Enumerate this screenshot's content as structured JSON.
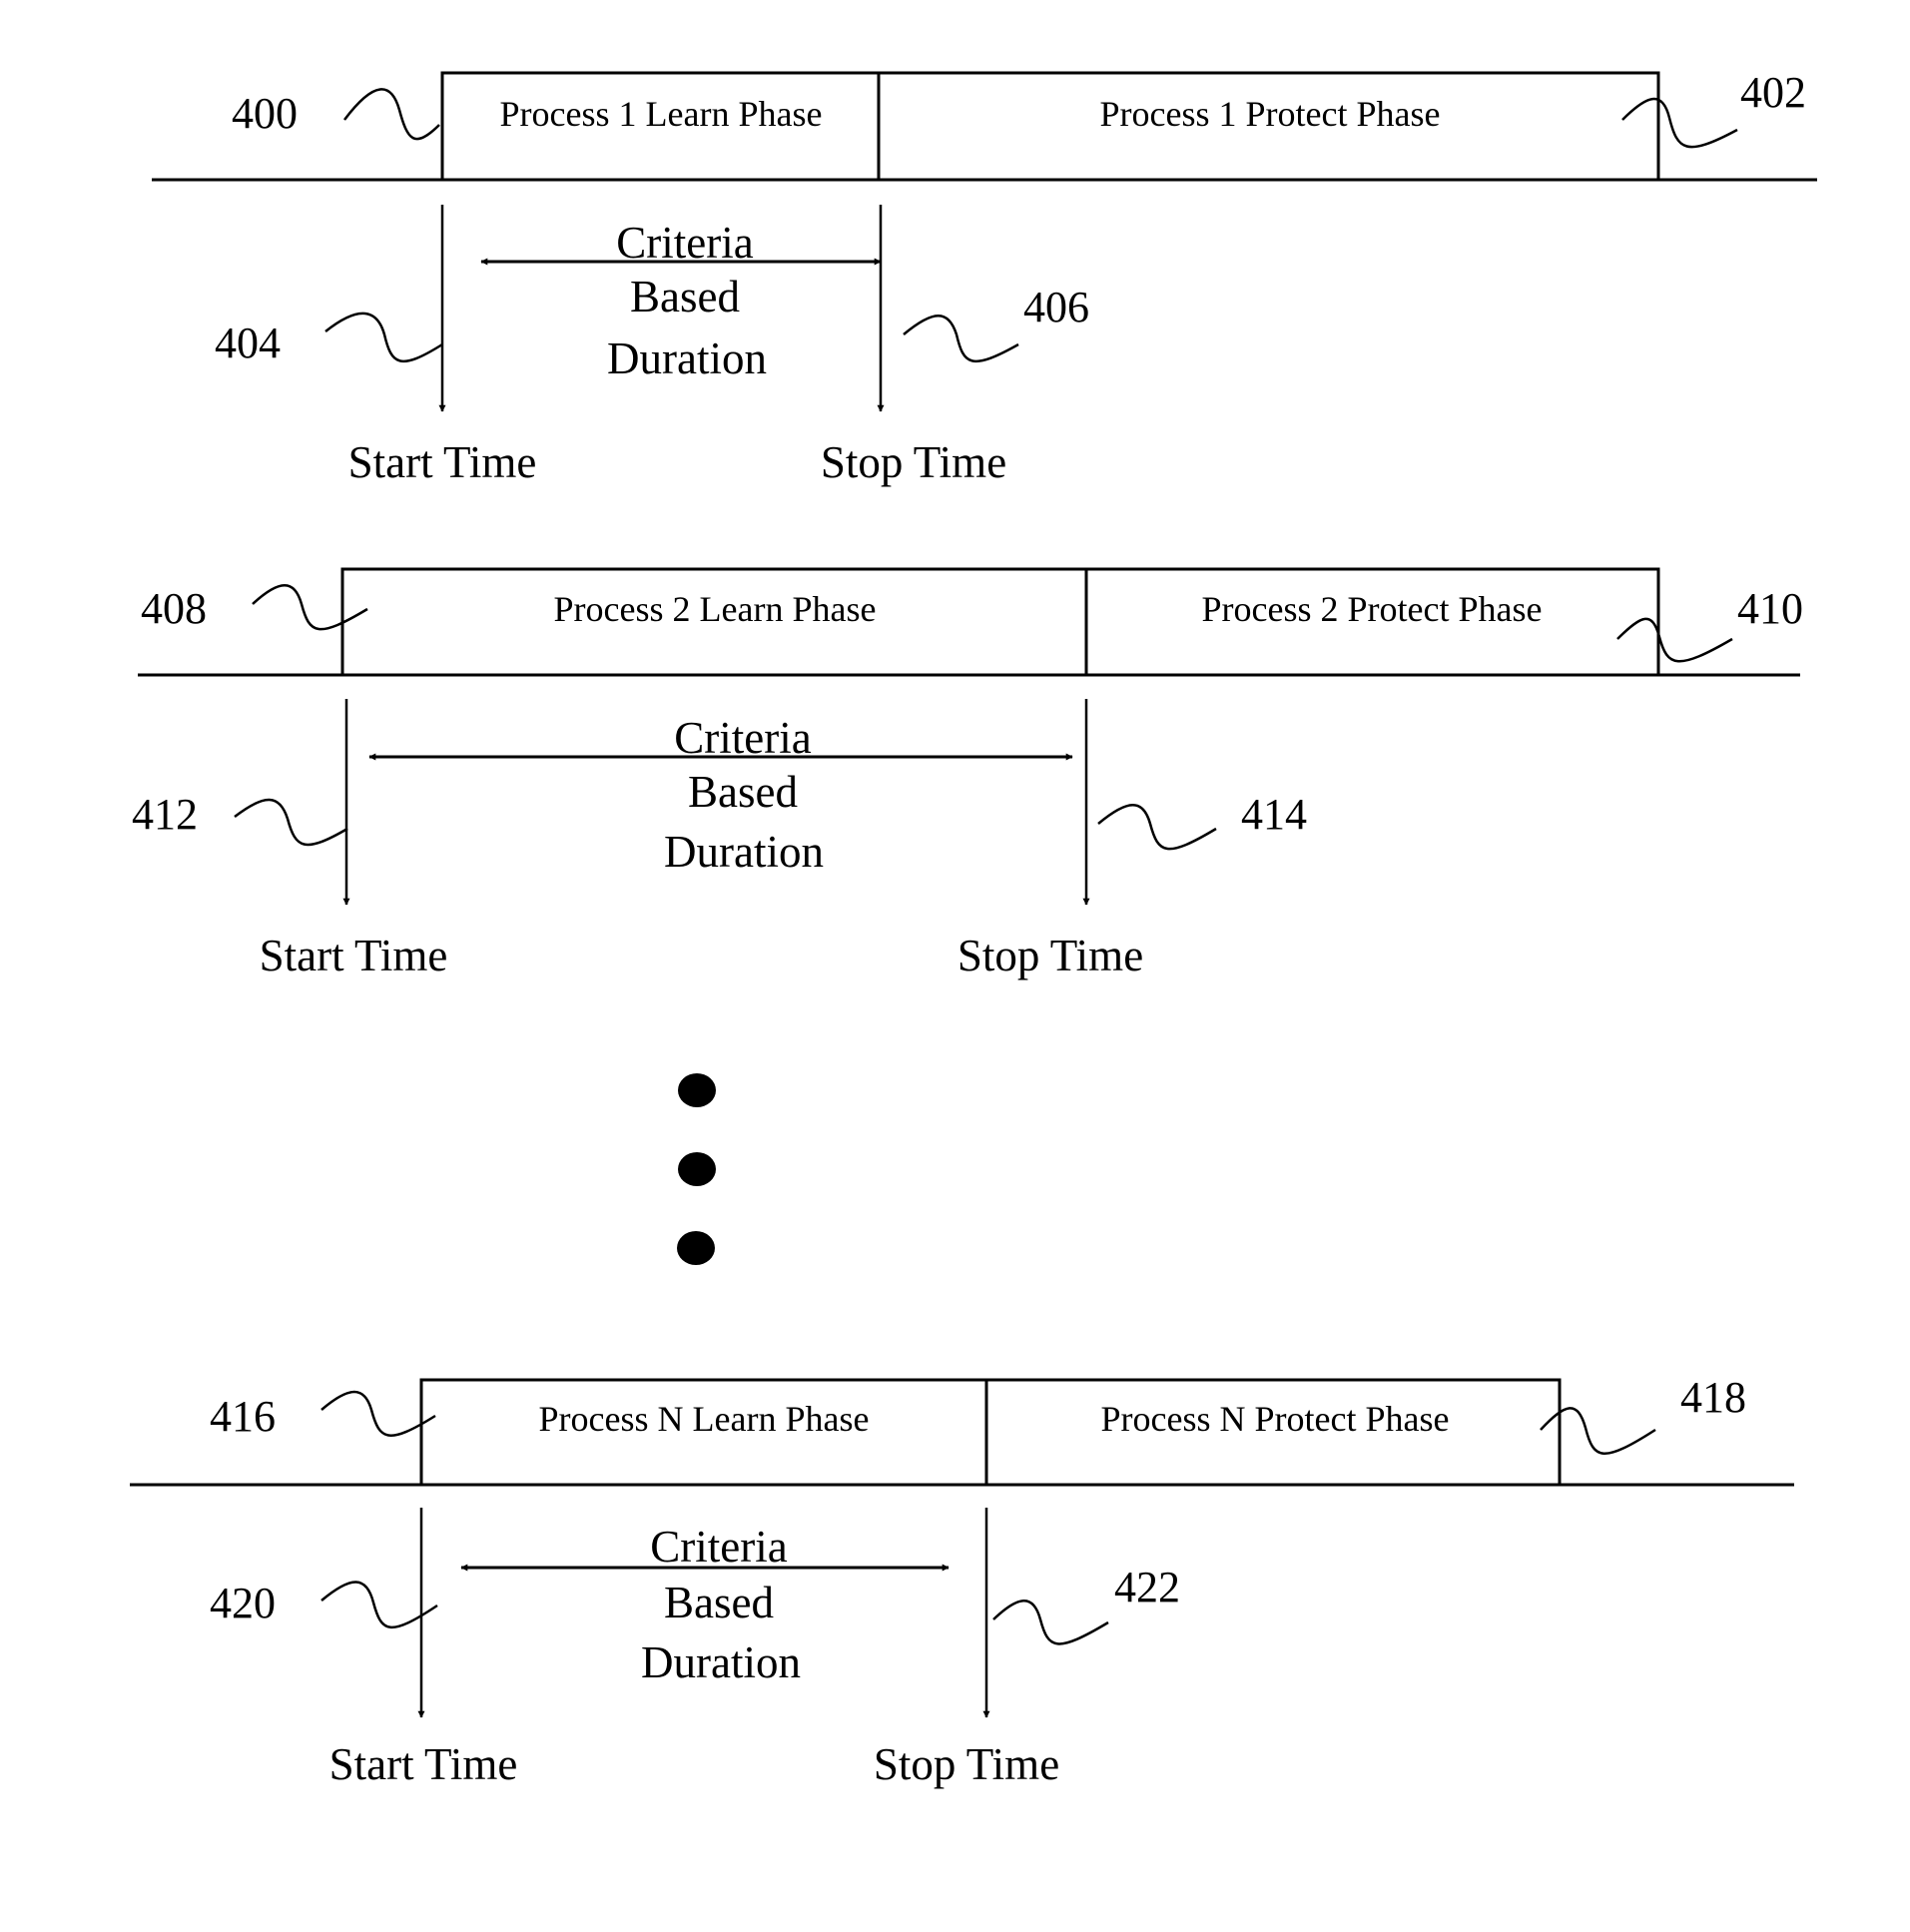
{
  "figure": {
    "processes": [
      {
        "learn_label": "Process 1 Learn Phase",
        "protect_label": "Process 1 Protect Phase",
        "duration_lines": [
          "Criteria",
          "Based",
          "Duration"
        ],
        "start_label": "Start Time",
        "stop_label": "Stop Time",
        "refs": {
          "learn": "400",
          "protect": "402",
          "start": "404",
          "stop": "406"
        }
      },
      {
        "learn_label": "Process 2 Learn Phase",
        "protect_label": "Process 2 Protect Phase",
        "duration_lines": [
          "Criteria",
          "Based",
          "Duration"
        ],
        "start_label": "Start Time",
        "stop_label": "Stop Time",
        "refs": {
          "learn": "408",
          "protect": "410",
          "start": "412",
          "stop": "414"
        }
      },
      {
        "learn_label": "Process N Learn Phase",
        "protect_label": "Process N Protect Phase",
        "duration_lines": [
          "Criteria",
          "Based",
          "Duration"
        ],
        "start_label": "Start Time",
        "stop_label": "Stop Time",
        "refs": {
          "learn": "416",
          "protect": "418",
          "start": "420",
          "stop": "422"
        }
      }
    ],
    "ellipsis_dots": 3
  }
}
